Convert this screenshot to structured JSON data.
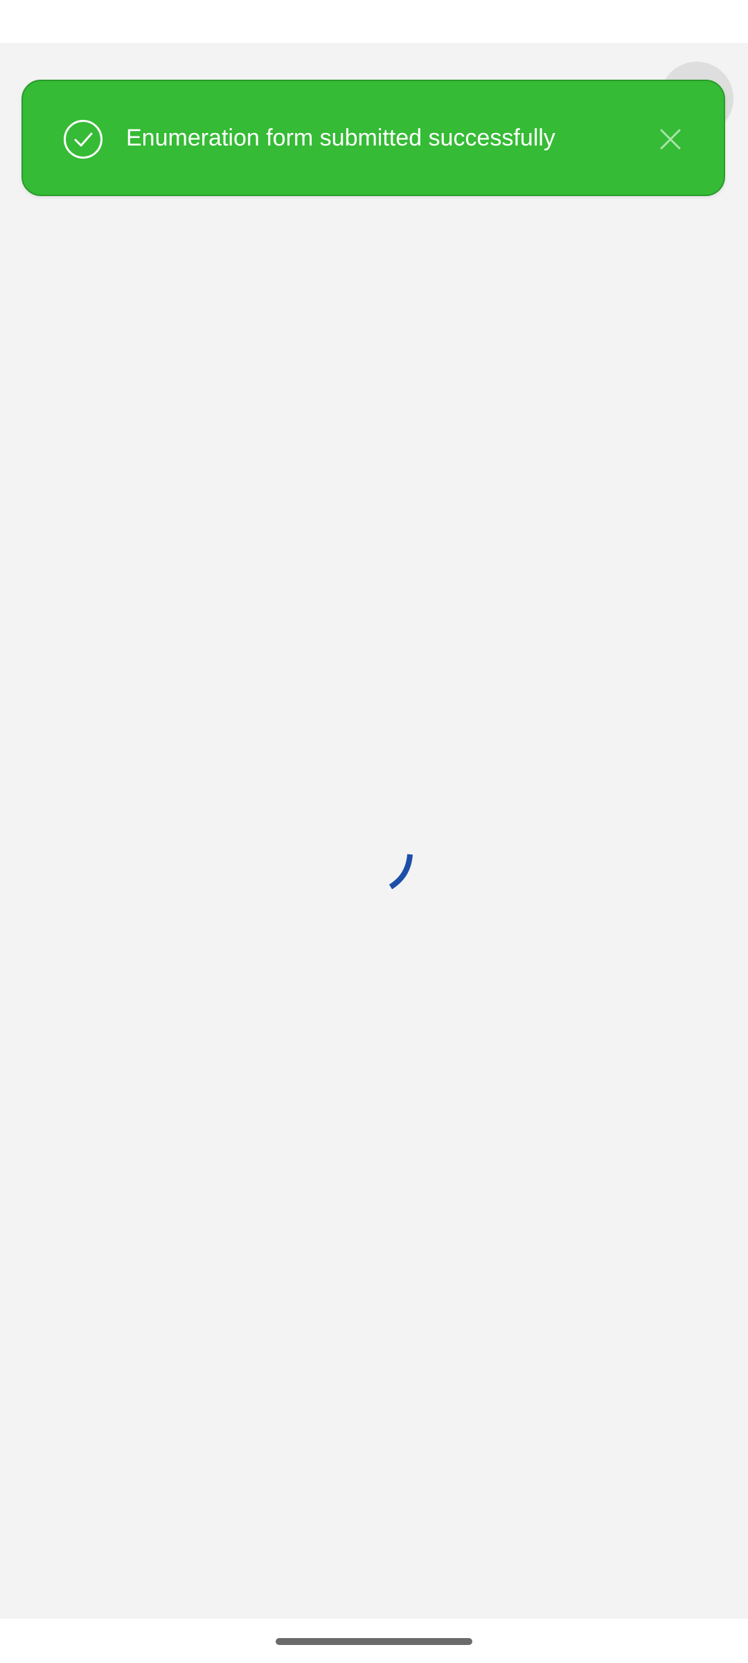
{
  "toast": {
    "message": "Enumeration form submitted successfully",
    "icon": "check-circle-icon",
    "close_icon": "close-icon",
    "background": "#35bb35"
  },
  "loader": {
    "icon": "loading-spinner",
    "color": "#1d4fa8"
  },
  "system": {
    "nav_bar_handle_color": "#6b6b6b"
  }
}
